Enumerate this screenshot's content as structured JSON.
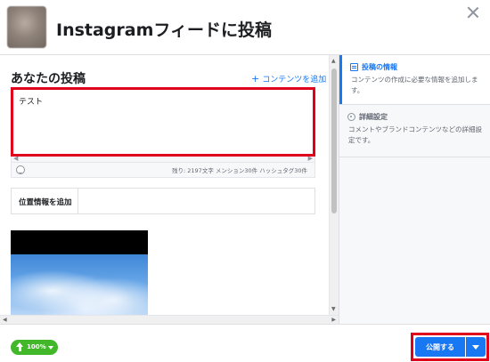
{
  "header": {
    "title": "Instagramフィードに投稿"
  },
  "post": {
    "section_title": "あなたの投稿",
    "add_content_label": "コンテンツを追加",
    "text_value": "テスト",
    "counter": "残り: 2197文字 メンション30件 ハッシュタグ30件",
    "location_label": "位置情報を追加"
  },
  "steps": [
    {
      "title": "投稿の情報",
      "description": "コンテンツの作成に必要な情報を追加します。",
      "active": true
    },
    {
      "title": "詳細設定",
      "description": "コメントやブランドコンテンツなどの詳細設定です。",
      "active": false
    }
  ],
  "footer": {
    "zoom": "100%",
    "publish_label": "公開する"
  },
  "colors": {
    "accent": "#1877f2",
    "green": "#42b72a",
    "highlight": "#e0001b"
  },
  "icons": [
    "close-icon",
    "plus-icon",
    "emoji-icon",
    "document-icon",
    "gear-icon",
    "upload-arrow-icon",
    "chevron-down-icon"
  ]
}
